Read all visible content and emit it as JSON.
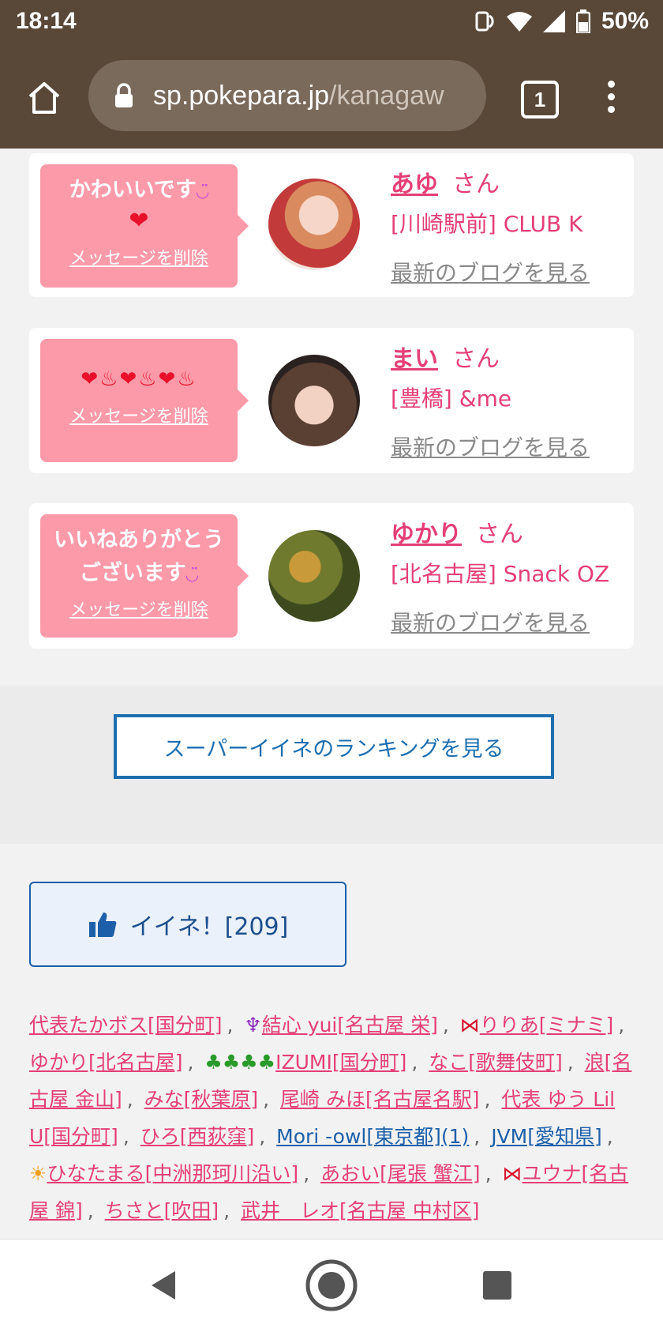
{
  "status_bar": {
    "time": "18:14",
    "battery": "50%"
  },
  "browser": {
    "url_host": "sp.pokepara.jp",
    "url_path": "/kanagaw",
    "tab_count": "1"
  },
  "messages": [
    {
      "message": "かわいいです",
      "delete_label": "メッセージを削除",
      "name": "あゆ",
      "honorific": "さん",
      "shop": "[川崎駅前] CLUB K",
      "blog_link": "最新のブログを見る"
    },
    {
      "message": "",
      "delete_label": "メッセージを削除",
      "name": "まい",
      "honorific": "さん",
      "shop": "[豊橋] &me",
      "blog_link": "最新のブログを見る"
    },
    {
      "message": "いいねありがとうございます",
      "delete_label": "メッセージを削除",
      "name": "ゆかり",
      "honorific": "さん",
      "shop": "[北名古屋] Snack OZ",
      "blog_link": "最新のブログを見る"
    }
  ],
  "ranking_button": "スーパーイイネのランキングを見る",
  "like_button": {
    "label": "イイネ！[209]"
  },
  "likers": [
    {
      "text": "代表たかボス[国分町]"
    },
    {
      "text": "結心 yui[名古屋 栄]"
    },
    {
      "text": "りりあ[ミナミ]"
    },
    {
      "text": "ゆかり[北名古屋]"
    },
    {
      "text": "IZUMI[国分町]"
    },
    {
      "text": "なこ[歌舞伎町]"
    },
    {
      "text": "浪[名古屋 金山]"
    },
    {
      "text": "みな[秋葉原]"
    },
    {
      "text": "尾崎 みほ[名古屋名駅]"
    },
    {
      "text": "代表 ゆう Lil U[国分町]"
    },
    {
      "text": "ひろ[西荻窪]"
    },
    {
      "text": "Mori -owl[東京都](1)"
    },
    {
      "text": "JVM[愛知県]"
    },
    {
      "text": "ひなたまる[中洲那珂川沿い]"
    },
    {
      "text": "あおい[尾張 蟹江]"
    },
    {
      "text": "ユウナ[名古屋 錦]"
    },
    {
      "text": "ちさと[吹田]"
    },
    {
      "text": "武井　レオ[名古屋 中村区]"
    }
  ],
  "colors": {
    "accent": "#e43f76",
    "bubble": "#fd9aa9",
    "chrome": "#594838",
    "link_blue": "#1d5fa8"
  }
}
